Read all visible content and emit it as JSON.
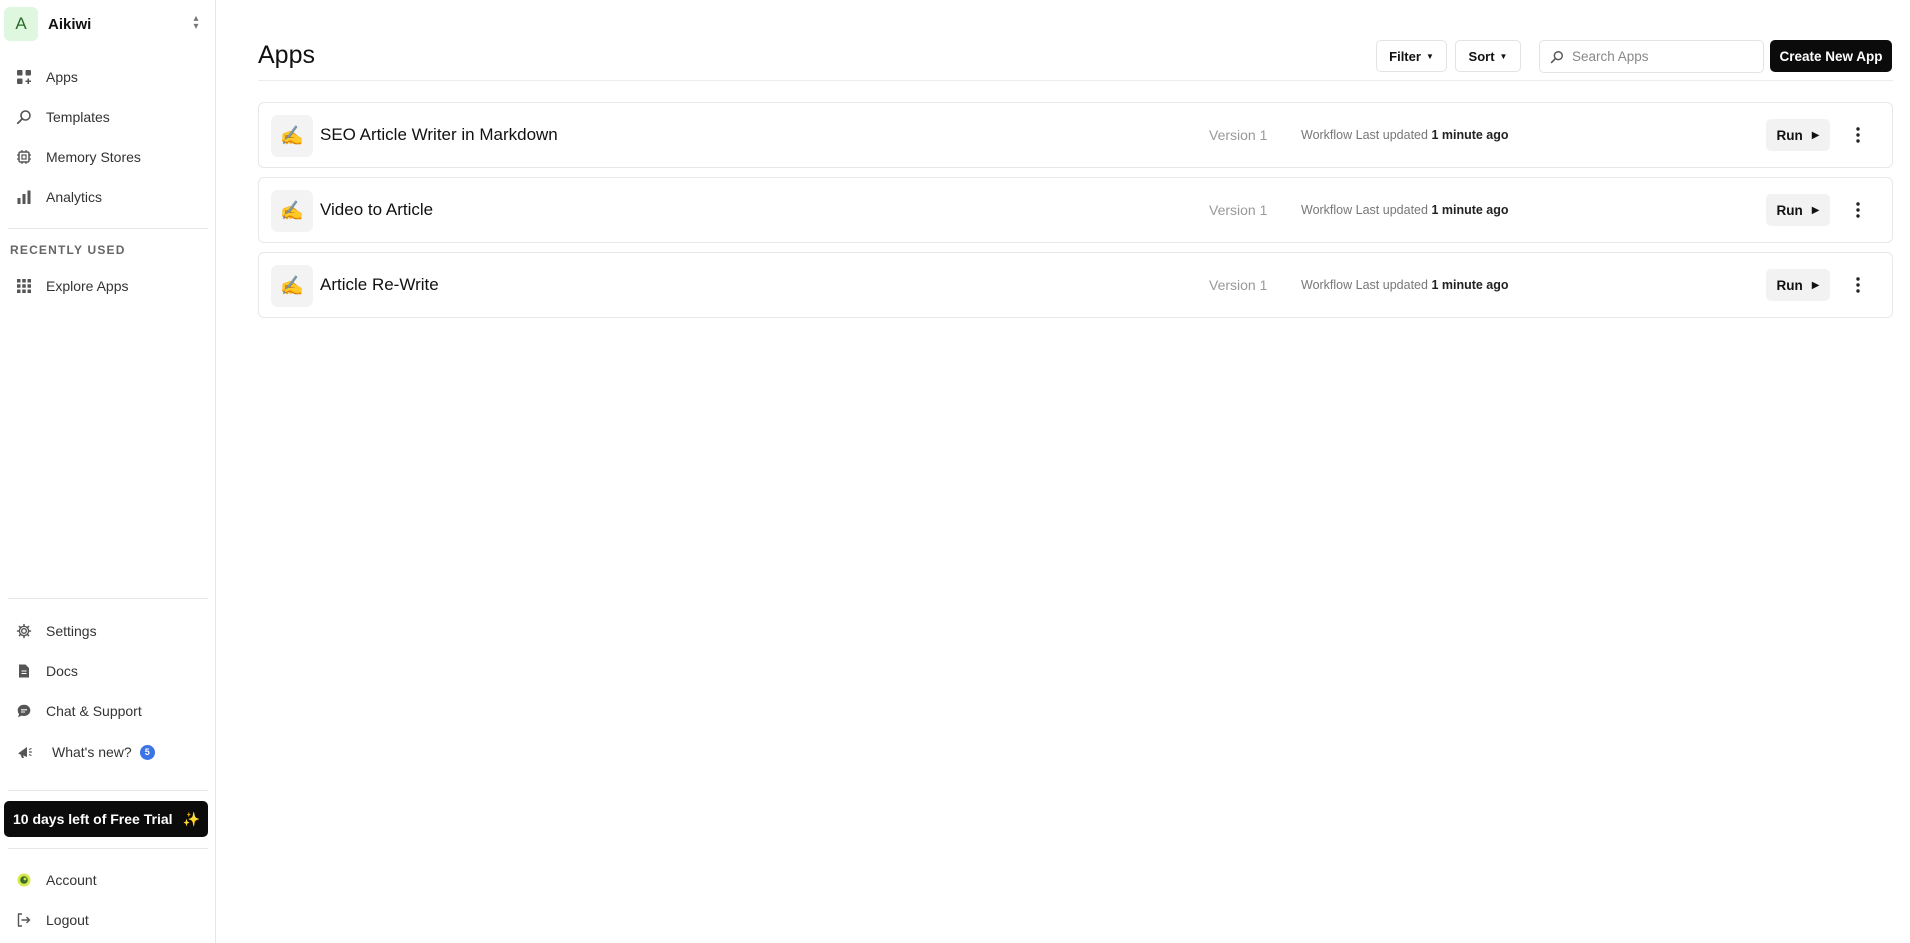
{
  "workspace": {
    "avatar": "A",
    "name": "Aikiwi"
  },
  "sidebar": {
    "nav": [
      {
        "label": "Apps",
        "icon": "grid-plus-icon"
      },
      {
        "label": "Templates",
        "icon": "search-icon"
      },
      {
        "label": "Memory Stores",
        "icon": "chip-icon"
      },
      {
        "label": "Analytics",
        "icon": "bar-chart-icon"
      }
    ],
    "section_label": "RECENTLY USED",
    "recent": [
      {
        "label": "Explore Apps",
        "icon": "dots-grid-icon"
      }
    ],
    "bottom": [
      {
        "label": "Settings",
        "icon": "gear-icon"
      },
      {
        "label": "Docs",
        "icon": "document-icon"
      },
      {
        "label": "Chat & Support",
        "icon": "chat-icon"
      },
      {
        "label": "What's new?",
        "icon": "megaphone-icon",
        "badge": "5"
      }
    ],
    "trial": "10 days left of Free Trial",
    "account": [
      {
        "label": "Account",
        "icon": "avatar-icon"
      },
      {
        "label": "Logout",
        "icon": "logout-icon"
      }
    ]
  },
  "header": {
    "title": "Apps",
    "filter_label": "Filter",
    "sort_label": "Sort",
    "search_placeholder": "Search Apps",
    "create_label": "Create New App"
  },
  "apps": [
    {
      "icon": "✍️",
      "name": "SEO Article Writer in Markdown",
      "version": "Version 1",
      "type": "Workflow",
      "updated_prefix": "Last updated",
      "updated": "1 minute ago",
      "run_label": "Run"
    },
    {
      "icon": "✍️",
      "name": "Video to Article",
      "version": "Version 1",
      "type": "Workflow",
      "updated_prefix": "Last updated",
      "updated": "1 minute ago",
      "run_label": "Run"
    },
    {
      "icon": "✍️",
      "name": "Article Re-Write",
      "version": "Version 1",
      "type": "Workflow",
      "updated_prefix": "Last updated",
      "updated": "1 minute ago",
      "run_label": "Run"
    }
  ],
  "colors": {
    "accent": "#0b0b0b",
    "badge": "#3b74e6",
    "workspace_avatar_bg": "#dff7df"
  }
}
